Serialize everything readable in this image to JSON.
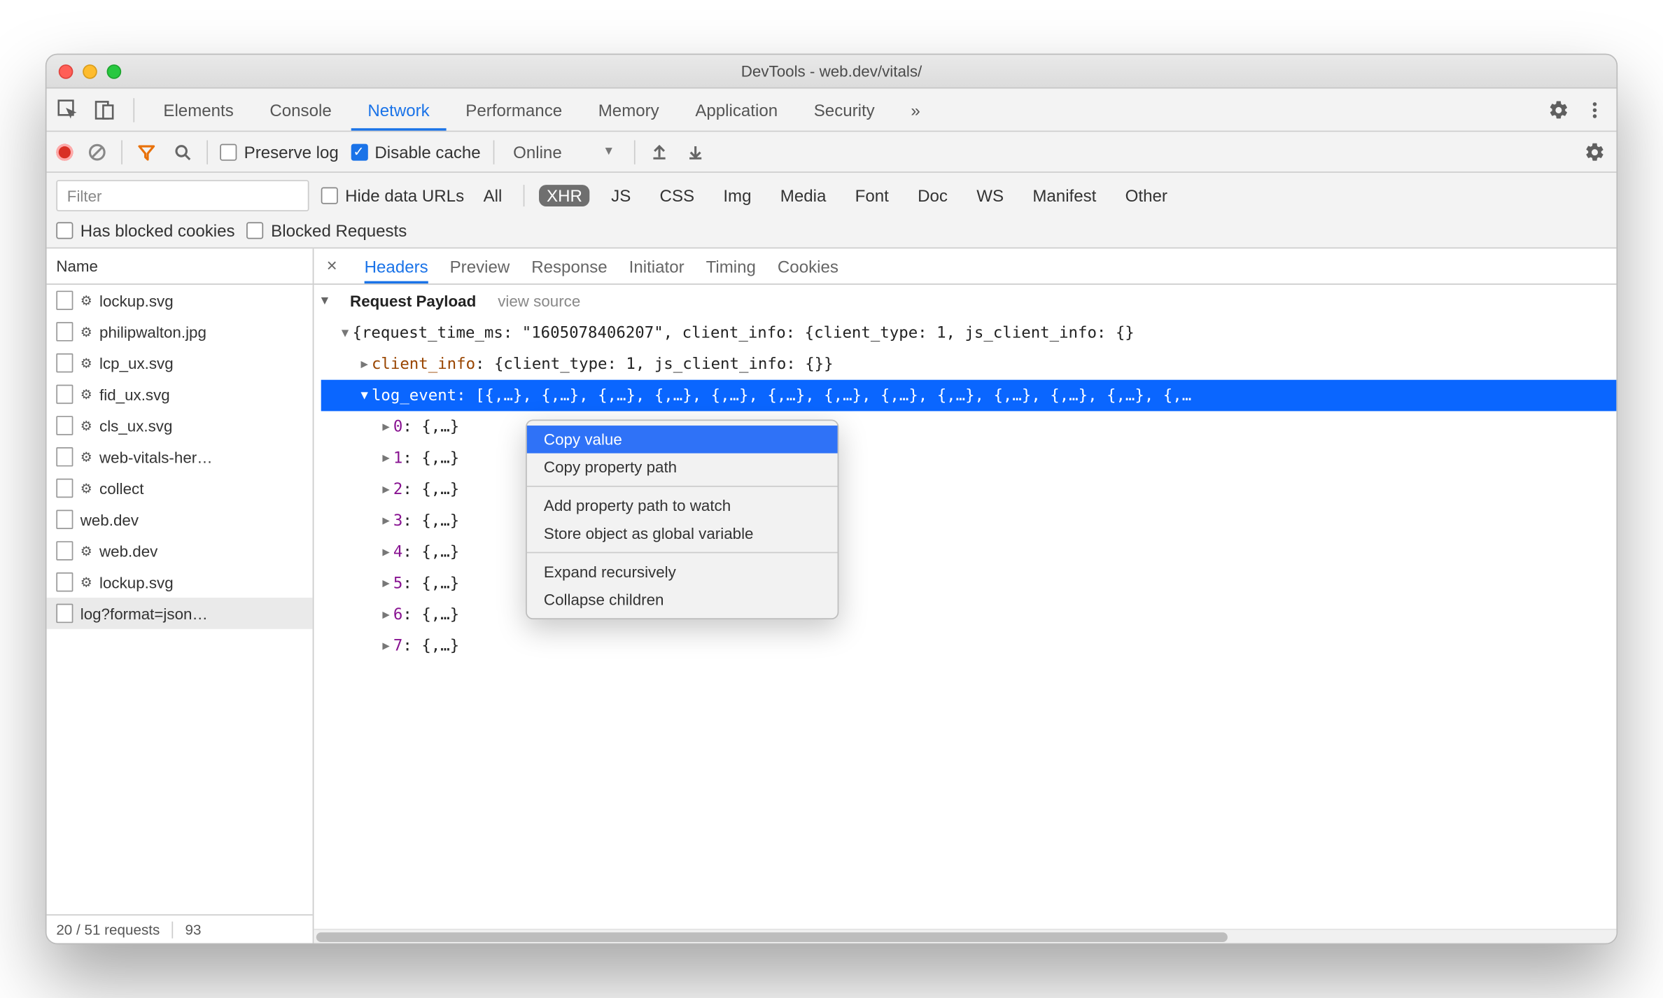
{
  "window": {
    "title": "DevTools - web.dev/vitals/"
  },
  "mainTabs": {
    "items": [
      "Elements",
      "Console",
      "Network",
      "Performance",
      "Memory",
      "Application",
      "Security"
    ],
    "active": "Network",
    "overflow": "»"
  },
  "toolbar": {
    "preserve_log": "Preserve log",
    "disable_cache": "Disable cache",
    "throttle": "Online"
  },
  "filterbar": {
    "placeholder": "Filter",
    "hide_data_urls": "Hide data URLs",
    "types": {
      "all": "All",
      "xhr": "XHR",
      "js": "JS",
      "css": "CSS",
      "img": "Img",
      "media": "Media",
      "font": "Font",
      "doc": "Doc",
      "ws": "WS",
      "manifest": "Manifest",
      "other": "Other"
    },
    "active_type": "xhr",
    "has_blocked": "Has blocked cookies",
    "blocked_requests": "Blocked Requests"
  },
  "sidebar": {
    "header": "Name",
    "items": [
      {
        "label": "lockup.svg",
        "gear": true
      },
      {
        "label": "philipwalton.jpg",
        "gear": true
      },
      {
        "label": "lcp_ux.svg",
        "gear": true
      },
      {
        "label": "fid_ux.svg",
        "gear": true
      },
      {
        "label": "cls_ux.svg",
        "gear": true
      },
      {
        "label": "web-vitals-her…",
        "gear": true
      },
      {
        "label": "collect",
        "gear": true
      },
      {
        "label": "web.dev",
        "gear": false
      },
      {
        "label": "web.dev",
        "gear": true
      },
      {
        "label": "lockup.svg",
        "gear": true
      },
      {
        "label": "log?format=json…",
        "gear": false,
        "selected": true
      }
    ],
    "status": {
      "left": "20 / 51 requests",
      "right": "93"
    }
  },
  "detail": {
    "tabs": [
      "Headers",
      "Preview",
      "Response",
      "Initiator",
      "Timing",
      "Cookies"
    ],
    "active": "Headers",
    "section_title": "Request Payload",
    "view_source": "view source",
    "root_line": "{request_time_ms: \"1605078406207\", client_info: {client_type: 1, js_client_info: {}",
    "client_info_key": "client_info",
    "client_info_val": "{client_type: 1, js_client_info: {}}",
    "log_event_key": "log_event",
    "log_event_preview": "[{,…}, {,…}, {,…}, {,…}, {,…}, {,…}, {,…}, {,…}, {,…}, {,…}, {,…}, {,…}, {,…",
    "children": [
      {
        "k": "0",
        "v": "{,…}"
      },
      {
        "k": "1",
        "v": "{,…}"
      },
      {
        "k": "2",
        "v": "{,…}"
      },
      {
        "k": "3",
        "v": "{,…}"
      },
      {
        "k": "4",
        "v": "{,…}"
      },
      {
        "k": "5",
        "v": "{,…}"
      },
      {
        "k": "6",
        "v": "{,…}"
      },
      {
        "k": "7",
        "v": "{,…}"
      }
    ]
  },
  "contextMenu": {
    "items": [
      "Copy value",
      "Copy property path",
      "-",
      "Add property path to watch",
      "Store object as global variable",
      "-",
      "Expand recursively",
      "Collapse children"
    ],
    "hover": "Copy value"
  }
}
